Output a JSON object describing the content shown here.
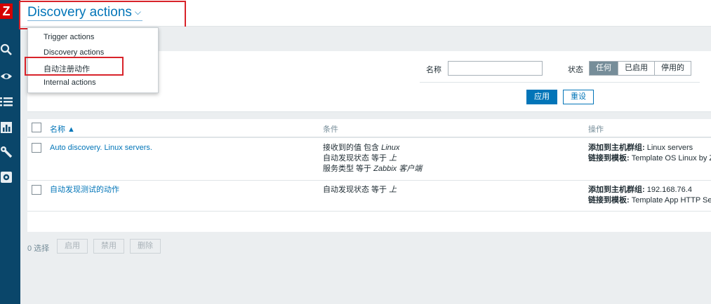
{
  "header": {
    "title": "Discovery actions",
    "chevron": "⌵"
  },
  "dropdown": {
    "items": [
      {
        "label": "Trigger actions"
      },
      {
        "label": "Discovery actions"
      },
      {
        "label": "自动注册动作"
      },
      {
        "label": "Internal actions"
      }
    ]
  },
  "filter": {
    "name_label": "名称",
    "name_value": "",
    "status_label": "状态",
    "status_options": [
      "任何",
      "已启用",
      "停用的"
    ],
    "status_selected": "任何",
    "apply_label": "应用",
    "reset_label": "重设"
  },
  "table": {
    "columns": {
      "name": "名称 ▲",
      "conditions": "条件",
      "operations": "操作"
    },
    "rows": [
      {
        "name": "Auto discovery. Linux servers.",
        "conditions": [
          {
            "prefix": "接收到的值 包含 ",
            "value": "Linux"
          },
          {
            "prefix": "自动发现状态 等于 ",
            "value": "上"
          },
          {
            "prefix": "服务类型 等于 ",
            "value": "Zabbix 客户端"
          }
        ],
        "operations": [
          {
            "label": "添加到主机群组:",
            "value": " Linux servers"
          },
          {
            "label": "链接到模板:",
            "value": " Template OS Linux by Z"
          }
        ]
      },
      {
        "name": "自动发现测试的动作",
        "conditions": [
          {
            "prefix": "自动发现状态 等于 ",
            "value": "上"
          }
        ],
        "operations": [
          {
            "label": "添加到主机群组:",
            "value": " 192.168.76.4"
          },
          {
            "label": "链接到模板:",
            "value": " Template App HTTP Ser"
          }
        ]
      }
    ]
  },
  "footer": {
    "selected": "0 选择",
    "enable": "启用",
    "disable": "禁用",
    "delete": "删除"
  },
  "colors": {
    "brand": "#0a466a",
    "accent": "#0275b8",
    "highlight": "#d8232a",
    "logo": "#d40000"
  },
  "icons": {
    "logo": "Z",
    "sidebar": [
      "search-icon",
      "eye-icon",
      "list-icon",
      "chart-icon",
      "wrench-icon",
      "gear-icon"
    ]
  }
}
